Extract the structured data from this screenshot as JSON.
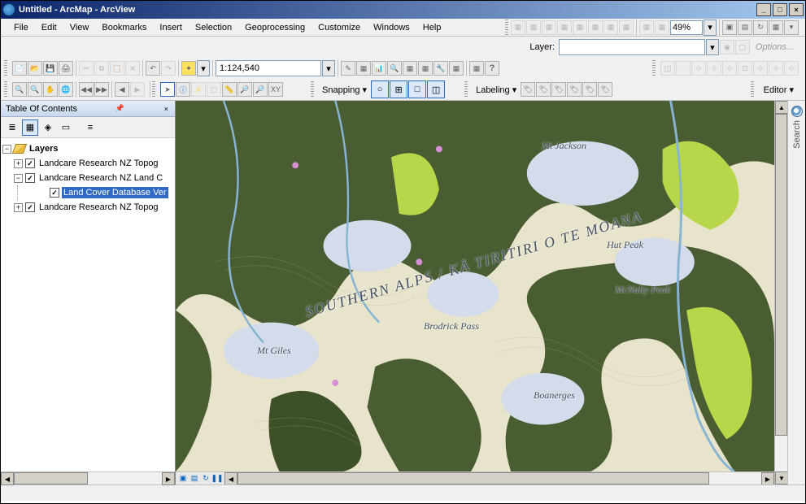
{
  "window": {
    "title": "Untitled - ArcMap - ArcView"
  },
  "menu": {
    "items": [
      "File",
      "Edit",
      "View",
      "Bookmarks",
      "Insert",
      "Selection",
      "Geoprocessing",
      "Customize",
      "Windows",
      "Help"
    ],
    "zoom_pct": "49%",
    "options_label": "Options..."
  },
  "toolbar": {
    "scale_value": "1:124,540",
    "layer_label": "Layer:",
    "snapping_label": "Snapping",
    "labeling_label": "Labeling",
    "editor_label": "Editor"
  },
  "toc": {
    "title": "Table Of Contents",
    "root_label": "Layers",
    "nodes": [
      {
        "label": "Landcare Research NZ Topog",
        "expanded": false,
        "checked": true,
        "selected": false,
        "level": 1
      },
      {
        "label": "Landcare Research NZ Land C",
        "expanded": true,
        "checked": true,
        "selected": false,
        "level": 1
      },
      {
        "label": "Land Cover Database Ver",
        "expanded": null,
        "checked": true,
        "selected": true,
        "level": 2
      },
      {
        "label": "Landcare Research NZ Topog",
        "expanded": false,
        "checked": true,
        "selected": false,
        "level": 1
      }
    ]
  },
  "map": {
    "labels": {
      "main_range": "SOUTHERN ALPS / KĀ TIRITIRI O TE MOANA",
      "mt_jackson": "Mt Jackson",
      "hut_peak": "Hut Peak",
      "mcnulty_peak": "McNulty Peak",
      "brodrick_pass": "Brodrick Pass",
      "mt_giles": "Mt Giles",
      "boanerges": "Boanerges"
    }
  },
  "search_tab": {
    "label": "Search"
  }
}
